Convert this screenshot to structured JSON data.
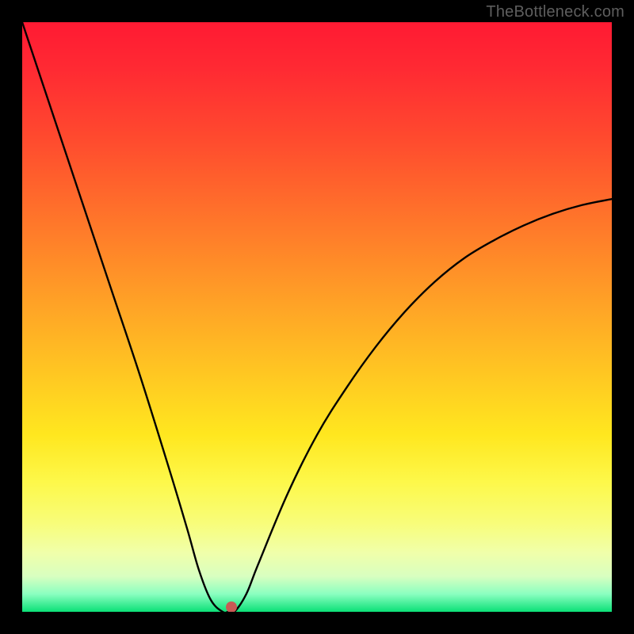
{
  "watermark": "TheBottleneck.com",
  "colors": {
    "frame": "#000000",
    "curve": "#000000",
    "dot": "#c95a55"
  },
  "chart_data": {
    "type": "line",
    "title": "",
    "xlabel": "",
    "ylabel": "",
    "xlim": [
      0,
      100
    ],
    "ylim": [
      0,
      100
    ],
    "grid": false,
    "series": [
      {
        "name": "bottleneck-curve",
        "x": [
          0,
          5,
          10,
          15,
          20,
          25,
          28,
          30,
          32,
          34,
          35,
          36,
          38,
          40,
          45,
          50,
          55,
          60,
          65,
          70,
          75,
          80,
          85,
          90,
          95,
          100
        ],
        "y": [
          100,
          85,
          70,
          55,
          40,
          24,
          14,
          7,
          2,
          0,
          0,
          0,
          3,
          8,
          20,
          30,
          38,
          45,
          51,
          56,
          60,
          63,
          65.5,
          67.5,
          69,
          70
        ]
      }
    ],
    "marker": {
      "x": 35.5,
      "y": 0.8
    },
    "gradient_stops": [
      {
        "pos": 0,
        "color": "#ff1a33"
      },
      {
        "pos": 8,
        "color": "#ff2a33"
      },
      {
        "pos": 20,
        "color": "#ff4b2e"
      },
      {
        "pos": 35,
        "color": "#ff7a2a"
      },
      {
        "pos": 48,
        "color": "#ffa326"
      },
      {
        "pos": 60,
        "color": "#ffc822"
      },
      {
        "pos": 70,
        "color": "#ffe71f"
      },
      {
        "pos": 78,
        "color": "#fdf84a"
      },
      {
        "pos": 85,
        "color": "#f8fd7a"
      },
      {
        "pos": 90,
        "color": "#f0ffaa"
      },
      {
        "pos": 94,
        "color": "#d8ffc0"
      },
      {
        "pos": 97,
        "color": "#8affc0"
      },
      {
        "pos": 100,
        "color": "#0be077"
      }
    ]
  }
}
